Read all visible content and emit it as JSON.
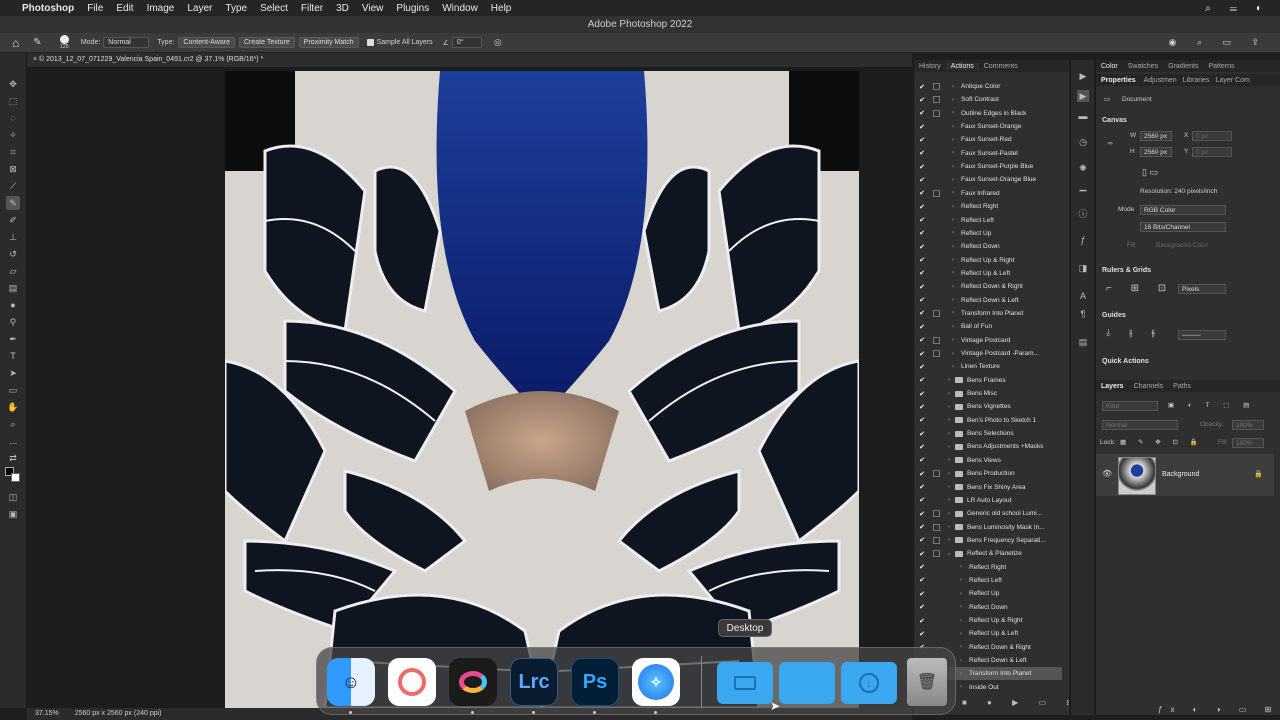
{
  "menubar": {
    "app": "Photoshop",
    "items": [
      "File",
      "Edit",
      "Image",
      "Layer",
      "Type",
      "Select",
      "Filter",
      "3D",
      "View",
      "Plugins",
      "Window",
      "Help"
    ]
  },
  "window_title": "Adobe Photoshop 2022",
  "options": {
    "brush_size": "125",
    "mode_label": "Mode:",
    "mode_value": "Normal",
    "type_label": "Type:",
    "type_options": [
      "Content-Aware",
      "Create Texture",
      "Proximity Match"
    ],
    "sample_all_layers": "Sample All Layers",
    "angle": "0°"
  },
  "document_tab": "© 2013_12_07_071229_Valencia Spain_0491.cr2 @ 37.1% (RGB/16*) *",
  "status": {
    "zoom": "37.15%",
    "info": "2560 px x 2560 px (240 ppi)"
  },
  "actions_panel": {
    "tabs": [
      "History",
      "Actions",
      "Comments"
    ],
    "items": [
      {
        "label": "Antique Color",
        "kind": "action",
        "checked": true,
        "dialog": true
      },
      {
        "label": "Soft Contrast",
        "kind": "action",
        "checked": true,
        "dialog": true
      },
      {
        "label": "Outline Edges in Black",
        "kind": "action",
        "checked": true,
        "dialog": true
      },
      {
        "label": "Faux Sunset-Orange",
        "kind": "action",
        "checked": true,
        "dialog": false
      },
      {
        "label": "Faux Sunset-Red",
        "kind": "action",
        "checked": true,
        "dialog": false
      },
      {
        "label": "Faux Sunset-Pastel",
        "kind": "action",
        "checked": true,
        "dialog": false
      },
      {
        "label": "Faux Sunset-Purple Blue",
        "kind": "action",
        "checked": true,
        "dialog": false
      },
      {
        "label": "Faux Sunset-Orange Blue",
        "kind": "action",
        "checked": true,
        "dialog": false
      },
      {
        "label": "Faux Infrared",
        "kind": "action",
        "checked": true,
        "dialog": true
      },
      {
        "label": "Reflect Right",
        "kind": "action",
        "checked": true,
        "dialog": false
      },
      {
        "label": "Reflect Left",
        "kind": "action",
        "checked": true,
        "dialog": false
      },
      {
        "label": "Reflect Up",
        "kind": "action",
        "checked": true,
        "dialog": false
      },
      {
        "label": "Reflect Down",
        "kind": "action",
        "checked": true,
        "dialog": false
      },
      {
        "label": "Reflect Up & Right",
        "kind": "action",
        "checked": true,
        "dialog": false
      },
      {
        "label": "Reflect Up & Left",
        "kind": "action",
        "checked": true,
        "dialog": false
      },
      {
        "label": "Reflect Down & Right",
        "kind": "action",
        "checked": true,
        "dialog": false
      },
      {
        "label": "Reflect Down & Left",
        "kind": "action",
        "checked": true,
        "dialog": false
      },
      {
        "label": "Transform Into Planet",
        "kind": "action",
        "checked": true,
        "dialog": true
      },
      {
        "label": "Ball of Fun",
        "kind": "action",
        "checked": true,
        "dialog": false
      },
      {
        "label": "Vintage Postcard",
        "kind": "action",
        "checked": true,
        "dialog": true
      },
      {
        "label": "Vintage Postcard -Param...",
        "kind": "action",
        "checked": true,
        "dialog": true
      },
      {
        "label": "Linen Texture",
        "kind": "action",
        "checked": true,
        "dialog": false
      },
      {
        "label": "Bens Frames",
        "kind": "set",
        "checked": true,
        "dialog": false
      },
      {
        "label": "Bens Misc",
        "kind": "set",
        "checked": true,
        "dialog": false
      },
      {
        "label": "Bens Vignettes",
        "kind": "set",
        "checked": true,
        "dialog": false
      },
      {
        "label": "Ben's Photo to Sketch 1",
        "kind": "set",
        "checked": true,
        "dialog": false
      },
      {
        "label": "Bens Selections",
        "kind": "set",
        "checked": true,
        "dialog": false
      },
      {
        "label": "Bens Adjustments +Masks",
        "kind": "set",
        "checked": true,
        "dialog": false
      },
      {
        "label": "Bens Views",
        "kind": "set",
        "checked": true,
        "dialog": false
      },
      {
        "label": "Bens Production",
        "kind": "set",
        "checked": true,
        "dialog": true
      },
      {
        "label": "Bens Fix Shiny Area",
        "kind": "set",
        "checked": true,
        "dialog": false
      },
      {
        "label": "LR Auto Layout",
        "kind": "set",
        "checked": true,
        "dialog": false
      },
      {
        "label": "Generic old school Lumi...",
        "kind": "set",
        "checked": true,
        "dialog": true
      },
      {
        "label": "Bens Luminosity Mask In...",
        "kind": "set",
        "checked": true,
        "dialog": true
      },
      {
        "label": "Bens Frequency Separati...",
        "kind": "set",
        "checked": true,
        "dialog": true
      },
      {
        "label": "Reflect & Planetize",
        "kind": "open-set",
        "checked": true,
        "dialog": true
      },
      {
        "label": "Reflect Right",
        "kind": "action",
        "checked": true,
        "dialog": false
      },
      {
        "label": "Reflect Left",
        "kind": "action",
        "checked": true,
        "dialog": false
      },
      {
        "label": "Reflect Up",
        "kind": "action",
        "checked": true,
        "dialog": false
      },
      {
        "label": "Reflect Down",
        "kind": "action",
        "checked": true,
        "dialog": false
      },
      {
        "label": "Reflect Up & Right",
        "kind": "action",
        "checked": true,
        "dialog": false
      },
      {
        "label": "Reflect Up & Left",
        "kind": "action",
        "checked": true,
        "dialog": false
      },
      {
        "label": "Reflect Down & Right",
        "kind": "action",
        "checked": true,
        "dialog": false
      },
      {
        "label": "Reflect Down & Left",
        "kind": "action",
        "checked": true,
        "dialog": false
      },
      {
        "label": "Transform Into Planet",
        "kind": "action",
        "checked": true,
        "dialog": false,
        "selected": true
      },
      {
        "label": "Inside Out",
        "kind": "action",
        "checked": true,
        "dialog": false
      }
    ]
  },
  "properties_panel": {
    "top_tabs": [
      "Color",
      "Swatches",
      "Gradients",
      "Patterns"
    ],
    "tabs": [
      "Properties",
      "Adjustmen",
      "Libraries",
      "Layer Com"
    ],
    "doc_label": "Document",
    "canvas_title": "Canvas",
    "w_label": "W",
    "w_value": "2560 px",
    "h_label": "H",
    "h_value": "2560 px",
    "x_label": "X",
    "y_label": "Y",
    "x_value": "0 px",
    "y_value": "0 px",
    "resolution": "Resolution: 240 pixels/inch",
    "mode_label": "Mode",
    "mode_value": "RGB Color",
    "bits_value": "16 Bits/Channel",
    "fill_label": "Fill",
    "fill_value": "Background Color",
    "rulers_title": "Rulers & Grids",
    "units_value": "Pixels",
    "guides_title": "Guides",
    "quick_actions_title": "Quick Actions"
  },
  "layers_panel": {
    "tabs": [
      "Layers",
      "Channels",
      "Paths"
    ],
    "kind_label": "Kind",
    "blend_value": "Normal",
    "opacity_label": "Opacity:",
    "opacity_value": "100%",
    "lock_label": "Lock:",
    "fill_label": "Fill:",
    "fill_value": "100%",
    "layer_name": "Background"
  },
  "dock": {
    "tooltip": "Desktop",
    "apps": [
      "Finder",
      "Tasks",
      "Creative Cloud",
      "Lightroom Classic",
      "Photoshop",
      "Safari",
      "Desktop",
      "Folder",
      "Downloads",
      "Trash"
    ],
    "lrc_text": "Lrc",
    "ps_text": "Ps"
  }
}
